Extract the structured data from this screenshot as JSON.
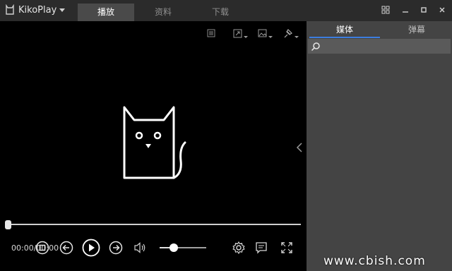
{
  "app": {
    "title": "KikoPlay"
  },
  "tabs": [
    {
      "label": "播放",
      "active": true
    },
    {
      "label": "资料",
      "active": false
    },
    {
      "label": "下载",
      "active": false
    }
  ],
  "window_buttons": [
    "grid-icon",
    "minimize-icon",
    "maximize-icon",
    "close-icon"
  ],
  "player": {
    "time": "00:00/00:00",
    "progress": 0.0,
    "volume": 0.3,
    "toolbar_icons": [
      "playlist-icon",
      "screenshot-icon",
      "image-icon",
      "pin-icon"
    ]
  },
  "side_panel": {
    "tabs": [
      {
        "label": "媒体",
        "active": true
      },
      {
        "label": "弹幕",
        "active": false
      }
    ],
    "search": {
      "placeholder": "",
      "value": ""
    }
  },
  "watermark": "www.cbish.com",
  "colors": {
    "accent": "#3c7de0",
    "titlebar": "#2b2b2b",
    "panel": "#444444",
    "video_bg": "#000000"
  }
}
